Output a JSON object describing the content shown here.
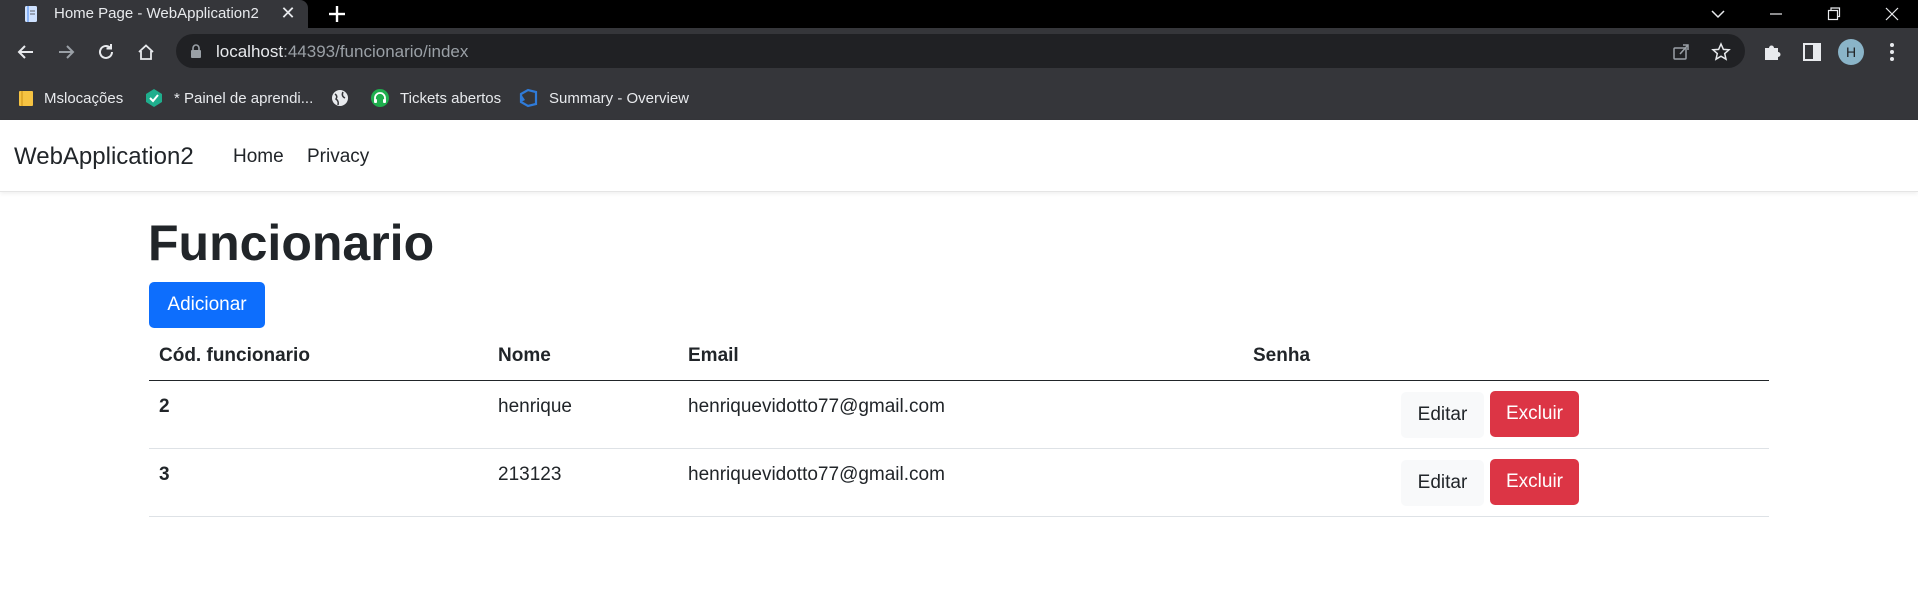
{
  "browser": {
    "tab": {
      "title": "Home Page - WebApplication2",
      "close": "✕"
    },
    "address": {
      "host": "localhost",
      "rest": ":44393/funcionario/index"
    },
    "profile_initial": "H",
    "bookmarks": [
      {
        "label": "Mslocações",
        "icon": "folder-icon"
      },
      {
        "label": "* Painel de aprendi...",
        "icon": "learning-icon"
      },
      {
        "label": "",
        "icon": "globe-icon"
      },
      {
        "label": "Tickets abertos",
        "icon": "headset-icon"
      },
      {
        "label": "Summary - Overview",
        "icon": "azure-devops-icon"
      }
    ]
  },
  "navbar": {
    "brand": "WebApplication2",
    "links": [
      "Home",
      "Privacy"
    ]
  },
  "main": {
    "title": "Funcionario",
    "add_label": "Adicionar",
    "table": {
      "headers": [
        "Cód. funcionario",
        "Nome",
        "Email",
        "Senha"
      ],
      "rows": [
        {
          "id": "2",
          "nome": "henrique",
          "email": "henriquevidotto77@gmail.com",
          "senha": ""
        },
        {
          "id": "3",
          "nome": "213123",
          "email": "henriquevidotto77@gmail.com",
          "senha": ""
        }
      ],
      "edit_label": "Editar",
      "delete_label": "Excluir"
    }
  },
  "colors": {
    "primary": "#0d6efd",
    "danger": "#dc3545",
    "light": "#f8f9fa",
    "chrome_toolbar": "#35363a"
  }
}
